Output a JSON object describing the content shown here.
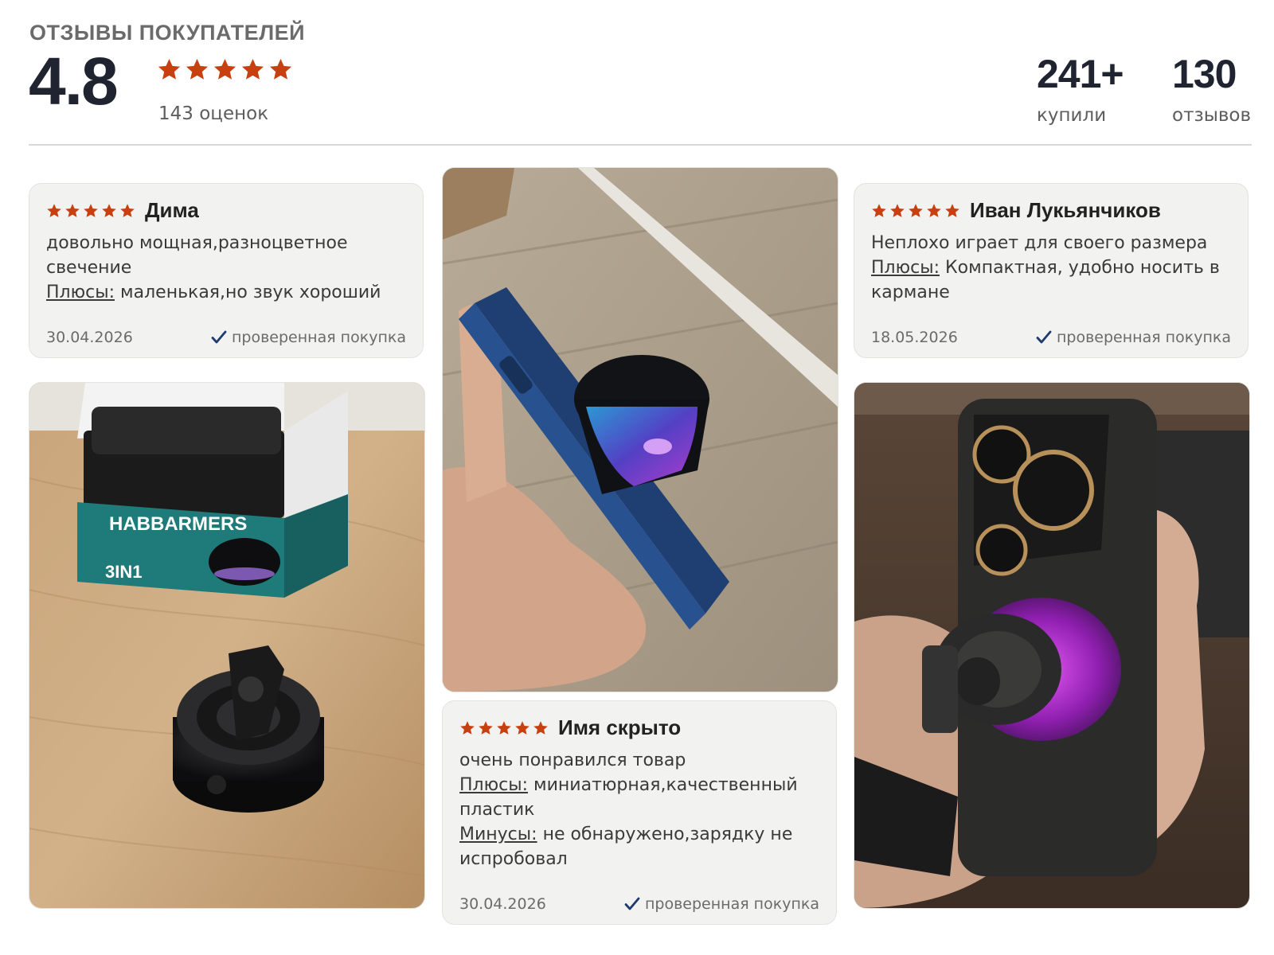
{
  "header": {
    "title": "ОТЗЫВЫ ПОКУПАТЕЛЕЙ",
    "rating": "4.8",
    "rating_count": "143 оценок",
    "stars": 5
  },
  "stats": {
    "bought_value": "241+",
    "bought_label": "купили",
    "reviews_value": "130",
    "reviews_label": "отзывов"
  },
  "colors": {
    "star": "#c8400f",
    "verified_check": "#1f3a6e",
    "card_bg": "#f2f2f0"
  },
  "reviews": [
    {
      "name": "Дима",
      "stars": 5,
      "text": "довольно мощная,разноцветное свечение",
      "pros_label": "Плюсы:",
      "pros": "маленькая,но звук хороший",
      "date": "30.04.2026",
      "verified": "проверенная покупка"
    },
    {
      "name": "Иван Лукьянчиков",
      "stars": 5,
      "text": "Неплохо играет для своего размера",
      "pros_label": "Плюсы:",
      "pros": "Компактная, удобно носить в кармане",
      "date": "18.05.2026",
      "verified": "проверенная покупка"
    },
    {
      "name": "Имя скрыто",
      "stars": 5,
      "text": "очень понравился товар",
      "pros_label": "Плюсы:",
      "pros": "миниатюрная,качественный пластик",
      "cons_label": "Минусы:",
      "cons": "не обнаружено,зарядку не испробовал",
      "date": "30.04.2026",
      "verified": "проверенная покупка"
    }
  ],
  "photos": {
    "photo1_box_text": "HABBARMERS",
    "photo1_box_sub": "3IN1"
  }
}
